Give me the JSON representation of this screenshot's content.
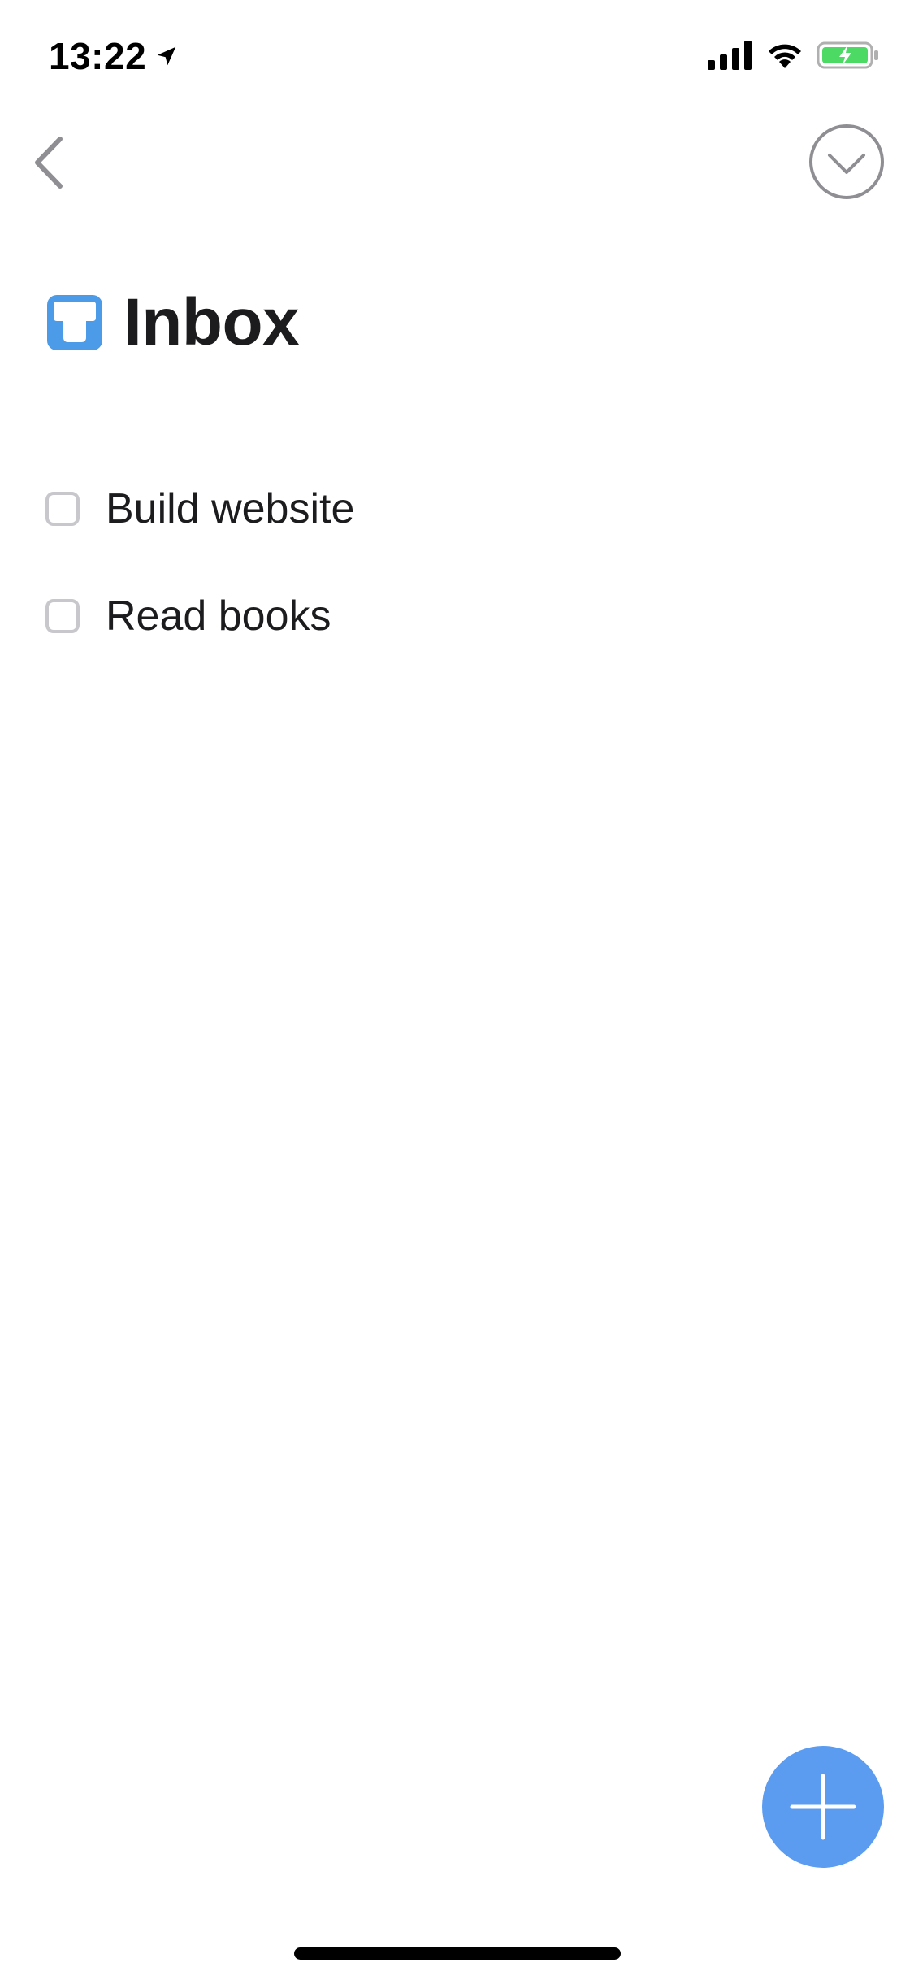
{
  "status_bar": {
    "time": "13:22",
    "location_icon": "location-arrow-icon",
    "signal_icon": "cellular-signal-icon",
    "wifi_icon": "wifi-icon",
    "battery_icon": "battery-charging-icon"
  },
  "nav": {
    "back_icon": "chevron-left-icon",
    "complete_icon": "circle-chevron-down-icon"
  },
  "header": {
    "title": "Inbox",
    "icon": "inbox-tray-icon",
    "icon_color": "#4c9be8"
  },
  "tasks": [
    {
      "label": "Build website",
      "checked": false
    },
    {
      "label": "Read books",
      "checked": false
    }
  ],
  "fab": {
    "icon": "plus-icon",
    "color": "#5b9cf0"
  },
  "colors": {
    "accent": "#5b9cf0",
    "battery_green": "#4cd964",
    "secondary_gray": "#8e8e93"
  }
}
